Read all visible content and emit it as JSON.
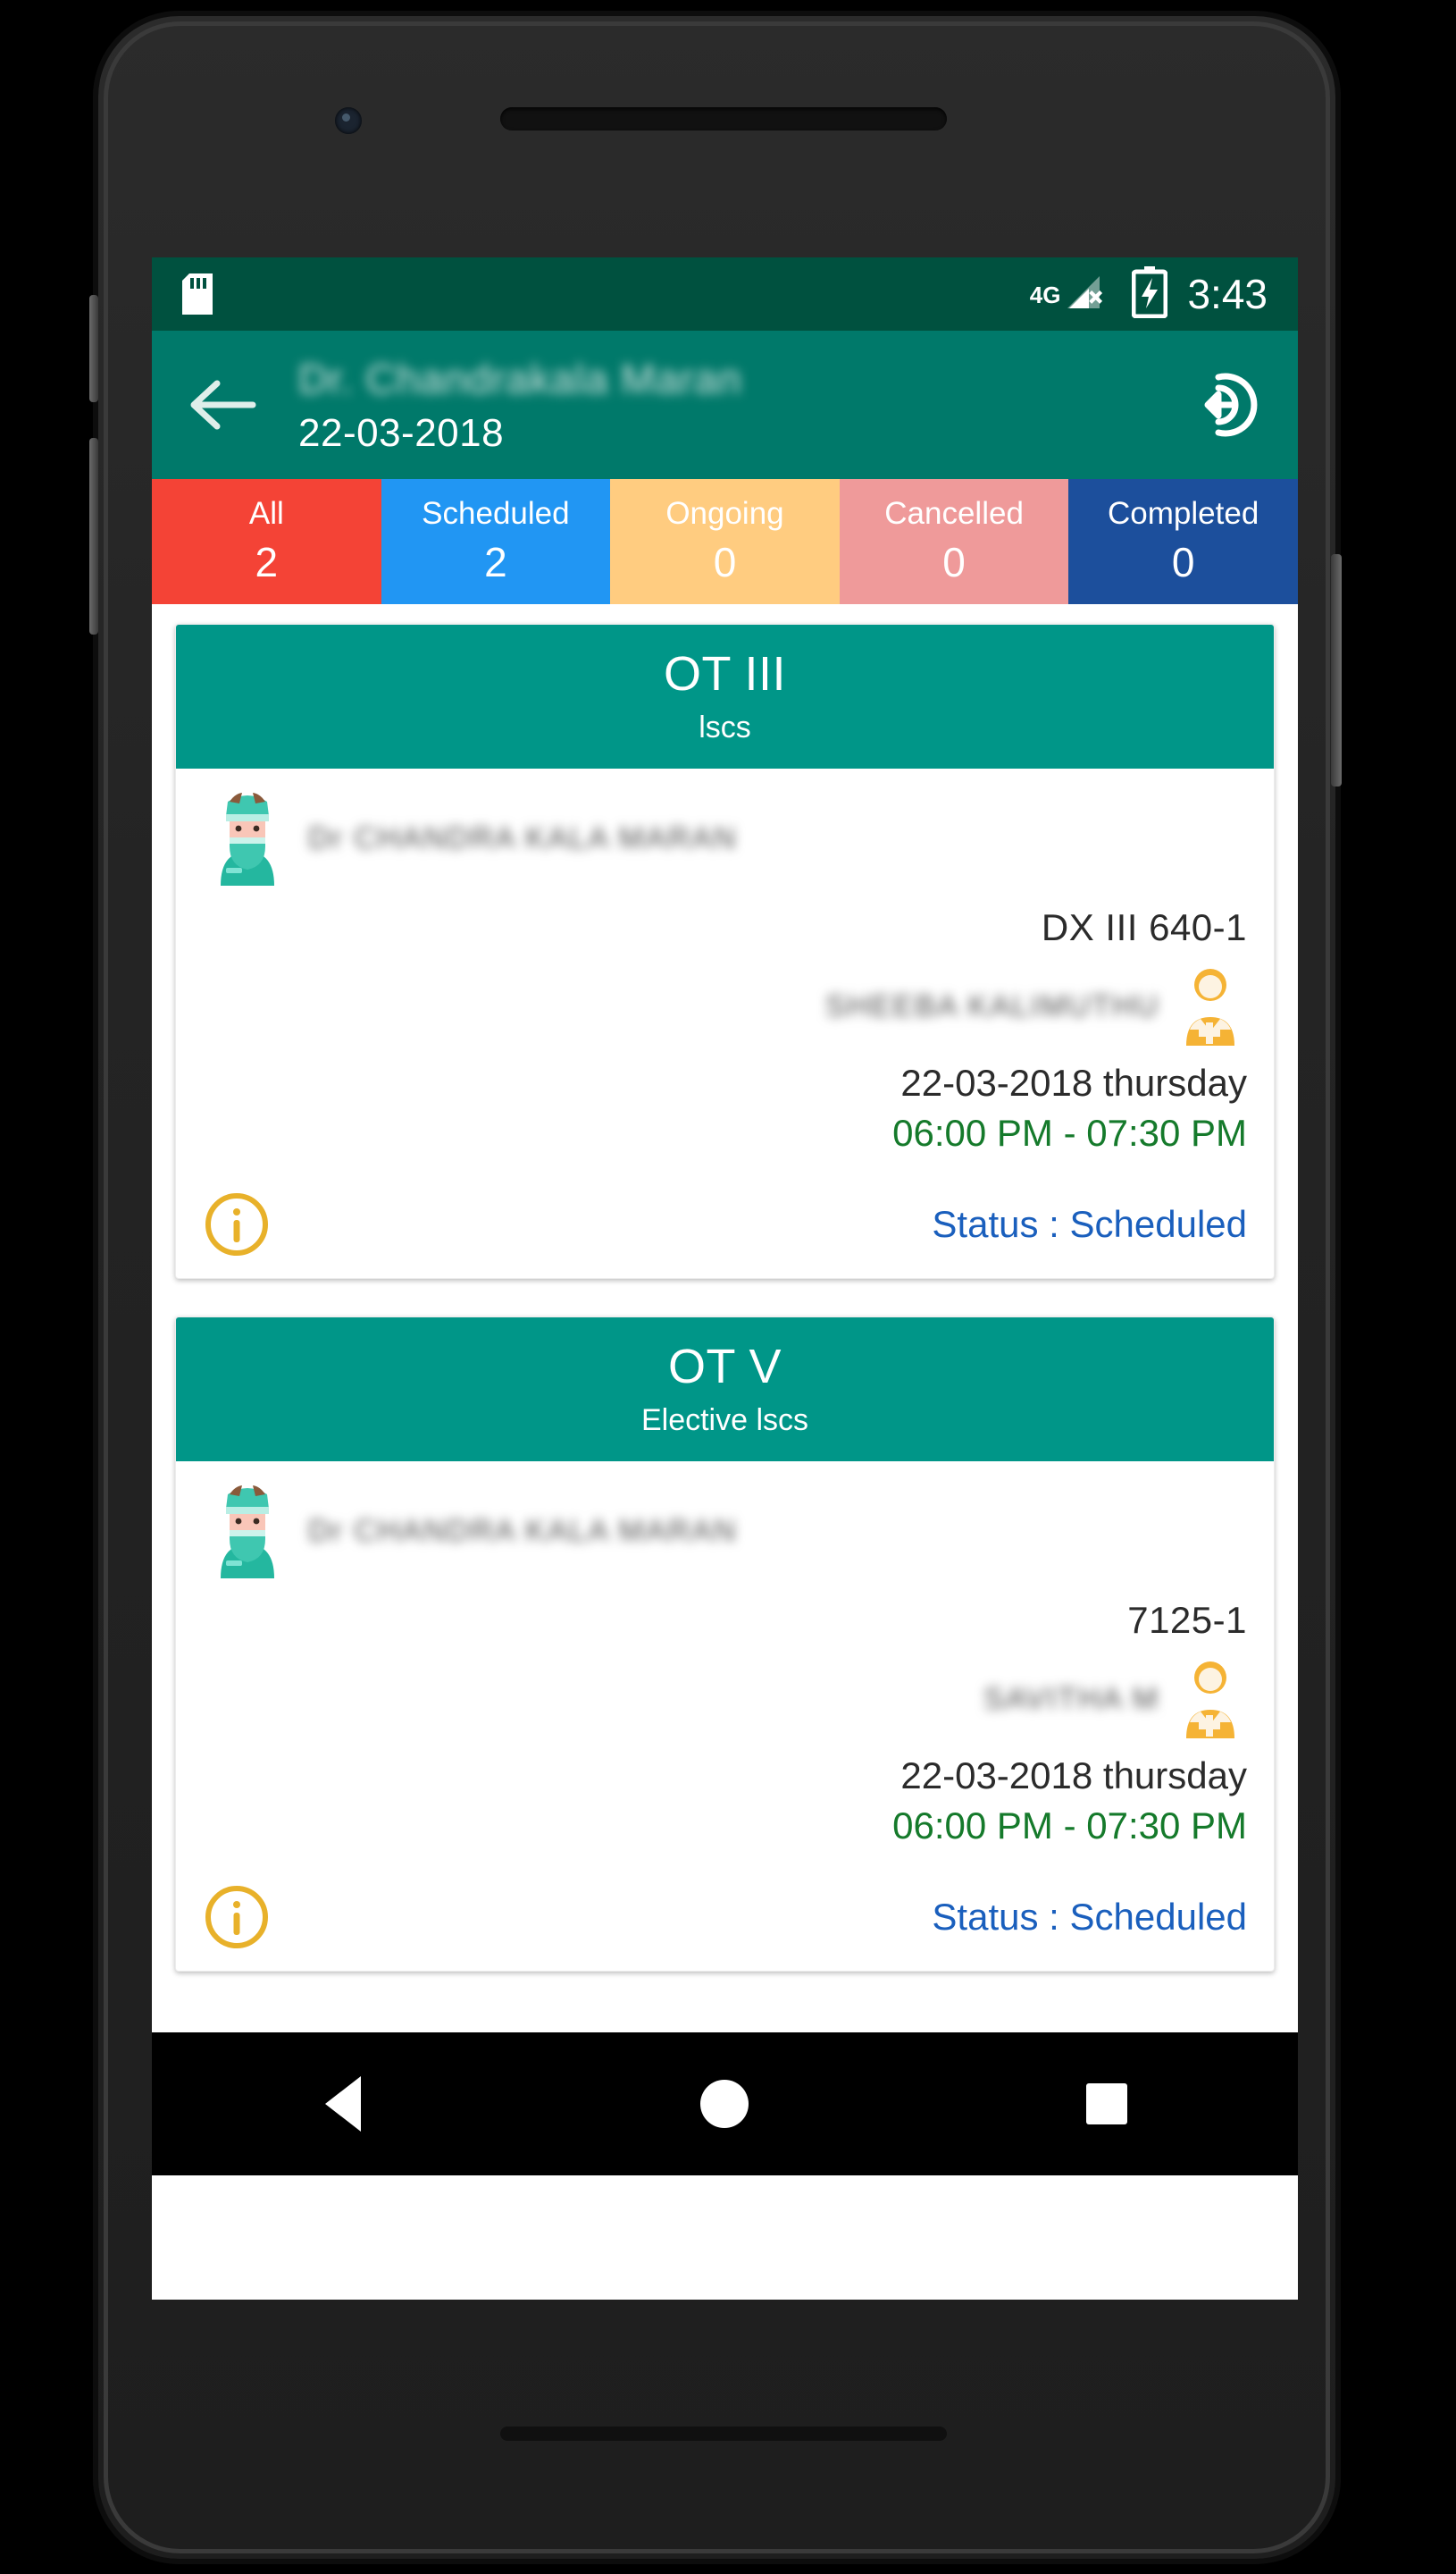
{
  "status_bar": {
    "sd_icon": "sd-card-icon",
    "network": "4G",
    "signal_state": "no-service",
    "battery_icon": "battery-charging-icon",
    "time": "3:43"
  },
  "app_bar": {
    "back_icon": "back-arrow-icon",
    "doctor_name": "Dr. Chandrakala Maran",
    "date": "22-03-2018",
    "logout_icon": "logout-icon"
  },
  "filter_tabs": [
    {
      "label": "All",
      "count": "2",
      "color": "#f44336"
    },
    {
      "label": "Scheduled",
      "count": "2",
      "color": "#2196f3"
    },
    {
      "label": "Ongoing",
      "count": "0",
      "color": "#ffcc80"
    },
    {
      "label": "Cancelled",
      "count": "0",
      "color": "#ef9a9a"
    },
    {
      "label": "Completed",
      "count": "0",
      "color": "#1c4f9c"
    }
  ],
  "cards": [
    {
      "theatre": "OT III",
      "procedure": "lscs",
      "surgeon_icon": "surgeon-icon",
      "surgeon_name": "Dr CHANDRA KALA MARAN",
      "operation_id": "DX III 640-1",
      "patient_icon": "patient-icon",
      "patient_name": "SHEEBA KALIMUTHU",
      "date": "22-03-2018 thursday",
      "time": "06:00 PM - 07:30 PM",
      "info_icon": "info-icon",
      "status": "Status : Scheduled"
    },
    {
      "theatre": "OT V",
      "procedure": "Elective lscs",
      "surgeon_icon": "surgeon-icon",
      "surgeon_name": "Dr CHANDRA KALA MARAN",
      "operation_id": "7125-1",
      "patient_icon": "patient-icon",
      "patient_name": "SAVITHA  M",
      "date": "22-03-2018 thursday",
      "time": "06:00 PM - 07:30 PM",
      "info_icon": "info-icon",
      "status": "Status : Scheduled"
    }
  ],
  "nav_bar": {
    "back": "android-back-icon",
    "home": "android-home-icon",
    "recents": "android-recents-icon"
  },
  "theme": {
    "status_bar_bg": "#00513f",
    "app_bar_bg": "#00796a",
    "card_head_bg": "#009688",
    "time_green": "#157a2b",
    "status_blue": "#1a5fbd",
    "info_yellow": "#e8b12a"
  }
}
